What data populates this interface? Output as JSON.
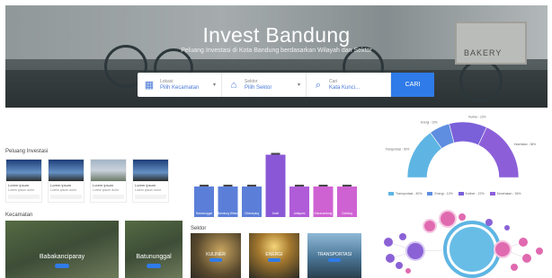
{
  "hero": {
    "title": "Invest Bandung",
    "subtitle": "Peluang Investasi di Kota Bandung berdasarkan Wilayah dan Sektor",
    "sign_text": "BAKERY"
  },
  "search": {
    "fields": [
      {
        "label": "Lokasi",
        "value": "Pilih Kecamatan",
        "icon": "map-icon"
      },
      {
        "label": "Sektor",
        "value": "Pilih Sektor",
        "icon": "graduation-cap-icon"
      },
      {
        "label": "Cari",
        "value": "Kata Kunci...",
        "icon": "search-icon"
      }
    ],
    "button_label": "CARI"
  },
  "peluang": {
    "title": "Peluang Investasi",
    "cards": [
      {
        "title": "Lorem ipsum",
        "sub": "Lorem ipsum dolor"
      },
      {
        "title": "Lorem ipsum",
        "sub": "Lorem ipsum dolor"
      },
      {
        "title": "Lorem ipsum",
        "sub": "Lorem ipsum dolor"
      },
      {
        "title": "Lorem ipsum",
        "sub": "Lorem ipsum dolor"
      }
    ]
  },
  "kecamatan": {
    "title": "Kecamatan",
    "items": [
      {
        "name": "Babakanciparay"
      },
      {
        "name": "Batununggal"
      }
    ]
  },
  "sektor": {
    "title": "Sektor",
    "items": [
      {
        "name": "KULINER"
      },
      {
        "name": "ENERGI"
      },
      {
        "name": "TRANSPORTASI"
      }
    ]
  },
  "colors": {
    "accent": "#2f7be9",
    "bar_blue": "#5b7fd8",
    "bar_purple": "#8a58d6",
    "bar_violet": "#b05cd8",
    "bar_magenta": "#cf62d2",
    "donut_light": "#5eb5e3",
    "donut_mid": "#5f8ee0",
    "donut_dark": "#7a60d9",
    "bubble_pink": "#e06ab0",
    "bubble_violet": "#8b62d6"
  },
  "chart_data": [
    {
      "type": "bar",
      "title": "",
      "categories": [
        "Batununggal",
        "Bandung Wetan",
        "Cibeunying",
        "Andir",
        "Antapani",
        "Kiaracondong",
        "Coblong"
      ],
      "values": [
        24,
        24,
        24,
        49,
        24,
        24,
        24
      ],
      "ylim": [
        0,
        55
      ],
      "colors": [
        "#5b7fd8",
        "#5b7fd8",
        "#5b7fd8",
        "#8a58d6",
        "#b05cd8",
        "#cf62d2",
        "#cf62d2"
      ]
    },
    {
      "type": "pie",
      "title": "",
      "labels": [
        "Transportasi",
        "Energi",
        "Kuliner",
        "Kesehatan"
      ],
      "values": [
        30,
        12,
        22,
        36
      ],
      "colors": [
        "#5eb5e3",
        "#5f8ee0",
        "#7a60d9",
        "#8c5fd9"
      ],
      "legend": "bottom",
      "legend_entries": [
        "Transportasi - 30%",
        "Energi - 12%",
        "Kuliner - 22%",
        "Kesehatan - 36%"
      ]
    }
  ]
}
